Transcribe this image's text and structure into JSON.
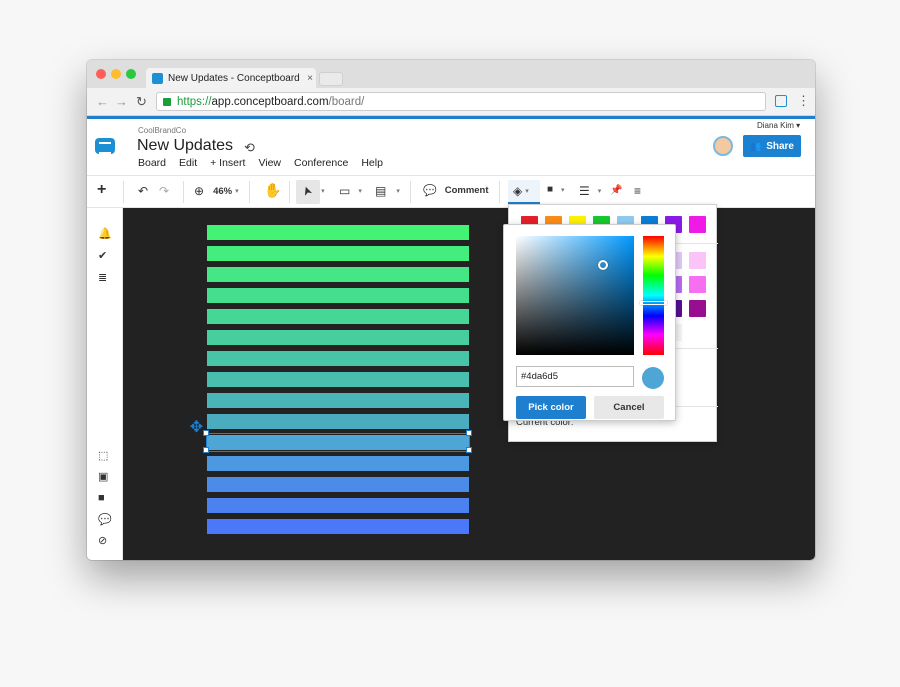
{
  "browser": {
    "tab_title": "New Updates - Conceptboard",
    "tab_close": "×",
    "url_scheme": "https://",
    "url_host": "app.conceptboard.com",
    "url_path": "/board/",
    "back_icon": "←",
    "forward_icon": "→",
    "reload_icon": "↻",
    "menu_icon": "⋮"
  },
  "header": {
    "company": "CoolBrandCo",
    "board_title": "New Updates",
    "sync_icon": "⟲",
    "user_name": "Diana Kim ▾",
    "share_label": "Share",
    "share_icon": "👥"
  },
  "menu": [
    "Board",
    "Edit",
    "+ Insert",
    "View",
    "Conference",
    "Help"
  ],
  "toolbar": {
    "add_icon": "+",
    "undo_icon": "↶",
    "redo_icon": "↷",
    "zoom_icon": "⊕",
    "zoom_level": "46%",
    "hand_icon": "✋",
    "select_icon": "➤",
    "shape_icon": "▭",
    "note_icon": "▤",
    "comment_icon": "💬",
    "comment_label": "Comment",
    "fill_icon": "◈",
    "color_icon": "■",
    "line_icon": "☰",
    "pin_icon": "📌",
    "list_icon": "≡",
    "caret": "▾"
  },
  "sidebar": {
    "bell_icon": "🔔",
    "check_icon": "✔",
    "list_icon": "≣",
    "select_icon": "⬚",
    "present_icon": "▣",
    "video_icon": "■",
    "chat_icon": "💬",
    "compass_icon": "⊘"
  },
  "canvas": {
    "bars": [
      "#43f474",
      "#43ee7e",
      "#44e686",
      "#45de8e",
      "#46d696",
      "#47cd9e",
      "#48c5a6",
      "#49bdae",
      "#4ab5b6",
      "#4bacbf",
      "#4da6d5",
      "#4c98e1",
      "#4b8ce8",
      "#4b82f0",
      "#4b78f8"
    ],
    "selected_index": 10,
    "move_icon": "✥"
  },
  "palette": {
    "primary": [
      "#e3202b",
      "#f98c18",
      "#fdf000",
      "#19c72e",
      "#8ecaf0",
      "#0b7ed4",
      "#8a1be6",
      "#f01ae6"
    ],
    "tints": [
      [
        "#f8c3c5",
        "#fddcc0",
        "#fdfcc2",
        "#c3efc9",
        "#e3f2fc",
        "#c6e2f6",
        "#e2c8f8",
        "#fbc4f6"
      ],
      [
        "#ee6c6f",
        "#fbb270",
        "#fbf76a",
        "#6bdc79",
        "#bde1f8",
        "#6fb5e8",
        "#b76cf0",
        "#f66ff0"
      ],
      [
        "#8c1216",
        "#a4560e",
        "#a4a20a",
        "#0f7d1c",
        "#5e94b6",
        "#084f86",
        "#560f92",
        "#970e90"
      ],
      [
        "#000000",
        "#555555",
        "#999999",
        "#cccccc",
        "#dddddd",
        "#eeeeee",
        "#f4f4f4",
        "#ffffff"
      ]
    ],
    "custom": [
      {
        "color": "#46d39a",
        "selected": false
      },
      {
        "color": "#48c5a6",
        "selected": false
      },
      {
        "color": "#4bacbf",
        "selected": false
      },
      {
        "color": "#4da6d5",
        "selected": true
      }
    ],
    "gear_icon": "⚙",
    "check_icon": "✔",
    "current_label": "Current color:"
  },
  "picker": {
    "hex_value": "#4da6d5",
    "preview_color": "#4da6d5",
    "pick_label": "Pick color",
    "cancel_label": "Cancel"
  },
  "colors": {
    "accent": "#1d7fce",
    "canvas_bg": "#222222"
  }
}
